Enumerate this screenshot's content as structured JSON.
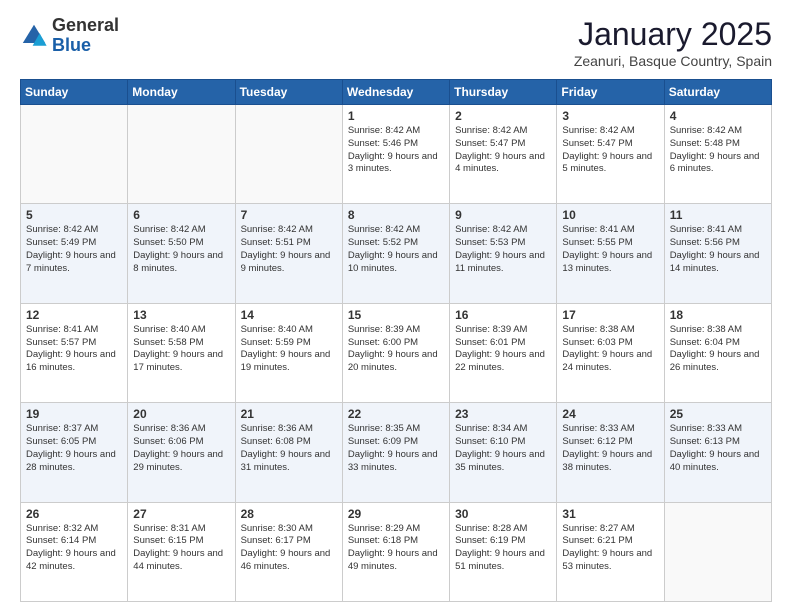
{
  "logo": {
    "general": "General",
    "blue": "Blue"
  },
  "header": {
    "title": "January 2025",
    "location": "Zeanuri, Basque Country, Spain"
  },
  "weekdays": [
    "Sunday",
    "Monday",
    "Tuesday",
    "Wednesday",
    "Thursday",
    "Friday",
    "Saturday"
  ],
  "weeks": [
    [
      {
        "day": "",
        "info": ""
      },
      {
        "day": "",
        "info": ""
      },
      {
        "day": "",
        "info": ""
      },
      {
        "day": "1",
        "info": "Sunrise: 8:42 AM\nSunset: 5:46 PM\nDaylight: 9 hours and 3 minutes."
      },
      {
        "day": "2",
        "info": "Sunrise: 8:42 AM\nSunset: 5:47 PM\nDaylight: 9 hours and 4 minutes."
      },
      {
        "day": "3",
        "info": "Sunrise: 8:42 AM\nSunset: 5:47 PM\nDaylight: 9 hours and 5 minutes."
      },
      {
        "day": "4",
        "info": "Sunrise: 8:42 AM\nSunset: 5:48 PM\nDaylight: 9 hours and 6 minutes."
      }
    ],
    [
      {
        "day": "5",
        "info": "Sunrise: 8:42 AM\nSunset: 5:49 PM\nDaylight: 9 hours and 7 minutes."
      },
      {
        "day": "6",
        "info": "Sunrise: 8:42 AM\nSunset: 5:50 PM\nDaylight: 9 hours and 8 minutes."
      },
      {
        "day": "7",
        "info": "Sunrise: 8:42 AM\nSunset: 5:51 PM\nDaylight: 9 hours and 9 minutes."
      },
      {
        "day": "8",
        "info": "Sunrise: 8:42 AM\nSunset: 5:52 PM\nDaylight: 9 hours and 10 minutes."
      },
      {
        "day": "9",
        "info": "Sunrise: 8:42 AM\nSunset: 5:53 PM\nDaylight: 9 hours and 11 minutes."
      },
      {
        "day": "10",
        "info": "Sunrise: 8:41 AM\nSunset: 5:55 PM\nDaylight: 9 hours and 13 minutes."
      },
      {
        "day": "11",
        "info": "Sunrise: 8:41 AM\nSunset: 5:56 PM\nDaylight: 9 hours and 14 minutes."
      }
    ],
    [
      {
        "day": "12",
        "info": "Sunrise: 8:41 AM\nSunset: 5:57 PM\nDaylight: 9 hours and 16 minutes."
      },
      {
        "day": "13",
        "info": "Sunrise: 8:40 AM\nSunset: 5:58 PM\nDaylight: 9 hours and 17 minutes."
      },
      {
        "day": "14",
        "info": "Sunrise: 8:40 AM\nSunset: 5:59 PM\nDaylight: 9 hours and 19 minutes."
      },
      {
        "day": "15",
        "info": "Sunrise: 8:39 AM\nSunset: 6:00 PM\nDaylight: 9 hours and 20 minutes."
      },
      {
        "day": "16",
        "info": "Sunrise: 8:39 AM\nSunset: 6:01 PM\nDaylight: 9 hours and 22 minutes."
      },
      {
        "day": "17",
        "info": "Sunrise: 8:38 AM\nSunset: 6:03 PM\nDaylight: 9 hours and 24 minutes."
      },
      {
        "day": "18",
        "info": "Sunrise: 8:38 AM\nSunset: 6:04 PM\nDaylight: 9 hours and 26 minutes."
      }
    ],
    [
      {
        "day": "19",
        "info": "Sunrise: 8:37 AM\nSunset: 6:05 PM\nDaylight: 9 hours and 28 minutes."
      },
      {
        "day": "20",
        "info": "Sunrise: 8:36 AM\nSunset: 6:06 PM\nDaylight: 9 hours and 29 minutes."
      },
      {
        "day": "21",
        "info": "Sunrise: 8:36 AM\nSunset: 6:08 PM\nDaylight: 9 hours and 31 minutes."
      },
      {
        "day": "22",
        "info": "Sunrise: 8:35 AM\nSunset: 6:09 PM\nDaylight: 9 hours and 33 minutes."
      },
      {
        "day": "23",
        "info": "Sunrise: 8:34 AM\nSunset: 6:10 PM\nDaylight: 9 hours and 35 minutes."
      },
      {
        "day": "24",
        "info": "Sunrise: 8:33 AM\nSunset: 6:12 PM\nDaylight: 9 hours and 38 minutes."
      },
      {
        "day": "25",
        "info": "Sunrise: 8:33 AM\nSunset: 6:13 PM\nDaylight: 9 hours and 40 minutes."
      }
    ],
    [
      {
        "day": "26",
        "info": "Sunrise: 8:32 AM\nSunset: 6:14 PM\nDaylight: 9 hours and 42 minutes."
      },
      {
        "day": "27",
        "info": "Sunrise: 8:31 AM\nSunset: 6:15 PM\nDaylight: 9 hours and 44 minutes."
      },
      {
        "day": "28",
        "info": "Sunrise: 8:30 AM\nSunset: 6:17 PM\nDaylight: 9 hours and 46 minutes."
      },
      {
        "day": "29",
        "info": "Sunrise: 8:29 AM\nSunset: 6:18 PM\nDaylight: 9 hours and 49 minutes."
      },
      {
        "day": "30",
        "info": "Sunrise: 8:28 AM\nSunset: 6:19 PM\nDaylight: 9 hours and 51 minutes."
      },
      {
        "day": "31",
        "info": "Sunrise: 8:27 AM\nSunset: 6:21 PM\nDaylight: 9 hours and 53 minutes."
      },
      {
        "day": "",
        "info": ""
      }
    ]
  ]
}
